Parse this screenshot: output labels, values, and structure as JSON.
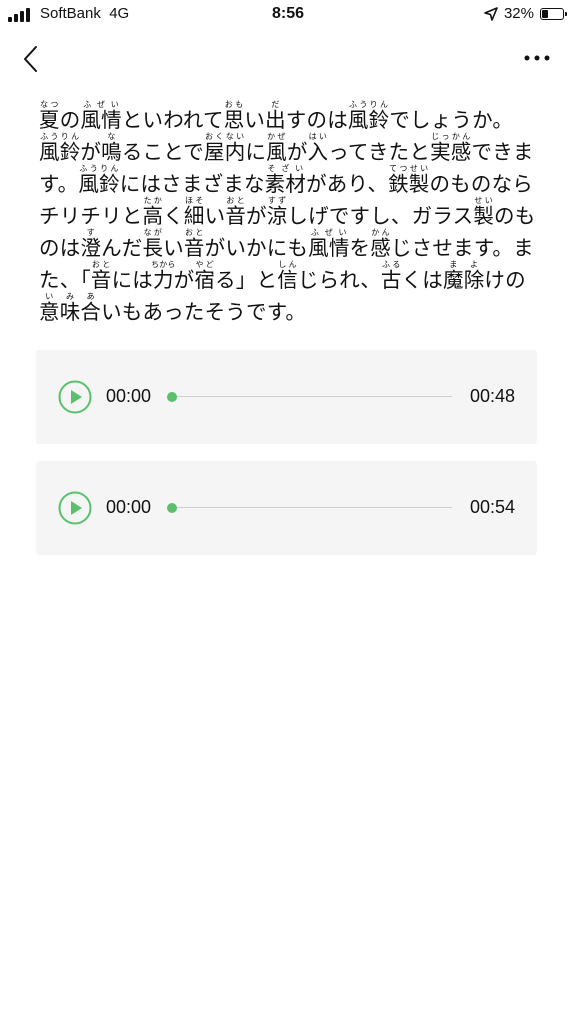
{
  "status_bar": {
    "carrier": "SoftBank",
    "network": "4G",
    "time": "8:56",
    "battery_percent": "32%",
    "battery_level": 0.32
  },
  "nav": {
    "back_icon": "chevron-left-icon",
    "more_icon": "more-horizontal-icon"
  },
  "article": {
    "segments": [
      {
        "t": "夏",
        "r": "なつ"
      },
      {
        "t": "の"
      },
      {
        "t": "風情",
        "r": "ふぜい"
      },
      {
        "t": "といわれて"
      },
      {
        "t": "思",
        "r": "おも"
      },
      {
        "t": "い"
      },
      {
        "t": "出",
        "r": "だ"
      },
      {
        "t": "すのは"
      },
      {
        "t": "風鈴",
        "r": "ふうりん"
      },
      {
        "t": "でしょうか。"
      },
      {
        "t": "風鈴",
        "r": "ふうりん"
      },
      {
        "t": "が"
      },
      {
        "t": "鳴",
        "r": "な"
      },
      {
        "t": "ることで"
      },
      {
        "t": "屋内",
        "r": "おくない"
      },
      {
        "t": "に"
      },
      {
        "t": "風",
        "r": "かぜ"
      },
      {
        "t": "が"
      },
      {
        "t": "入",
        "r": "はい"
      },
      {
        "t": "ってきたと"
      },
      {
        "t": "実感",
        "r": "じっかん"
      },
      {
        "t": "できます。"
      },
      {
        "t": "風鈴",
        "r": "ふうりん"
      },
      {
        "t": "にはさまざまな"
      },
      {
        "t": "素材",
        "r": "そざい"
      },
      {
        "t": "があり、"
      },
      {
        "t": "鉄製",
        "r": "てつせい"
      },
      {
        "t": "のものならチリチリと"
      },
      {
        "t": "高",
        "r": "たか"
      },
      {
        "t": "く"
      },
      {
        "t": "細",
        "r": "ほそ"
      },
      {
        "t": "い"
      },
      {
        "t": "音",
        "r": "おと"
      },
      {
        "t": "が"
      },
      {
        "t": "涼",
        "r": "すず"
      },
      {
        "t": "しげですし、ガラス"
      },
      {
        "t": "製",
        "r": "せい"
      },
      {
        "t": "のものは"
      },
      {
        "t": "澄",
        "r": "す"
      },
      {
        "t": "んだ"
      },
      {
        "t": "長",
        "r": "なが"
      },
      {
        "t": "い"
      },
      {
        "t": "音",
        "r": "おと"
      },
      {
        "t": "がいかにも"
      },
      {
        "t": "風情",
        "r": "ふぜい"
      },
      {
        "t": "を"
      },
      {
        "t": "感",
        "r": "かん"
      },
      {
        "t": "じさせます。また、「"
      },
      {
        "t": "音",
        "r": "おと"
      },
      {
        "t": "には"
      },
      {
        "t": "力",
        "r": "ちから"
      },
      {
        "t": "が"
      },
      {
        "t": "宿",
        "r": "やど"
      },
      {
        "t": "る」と"
      },
      {
        "t": "信",
        "r": "しん"
      },
      {
        "t": "じられ、"
      },
      {
        "t": "古",
        "r": "ふる"
      },
      {
        "t": "くは"
      },
      {
        "t": "魔除",
        "r": "まよ"
      },
      {
        "t": "けの"
      },
      {
        "t": "意味合",
        "r": "いみあ"
      },
      {
        "t": "いもあったそうです。"
      }
    ]
  },
  "audio_players": [
    {
      "current_time": "00:00",
      "duration": "00:48",
      "progress": 0.0,
      "play_icon": "play-icon",
      "accent_color": "#5ac06b"
    },
    {
      "current_time": "00:00",
      "duration": "00:54",
      "progress": 0.0,
      "play_icon": "play-icon",
      "accent_color": "#5ac06b"
    }
  ]
}
